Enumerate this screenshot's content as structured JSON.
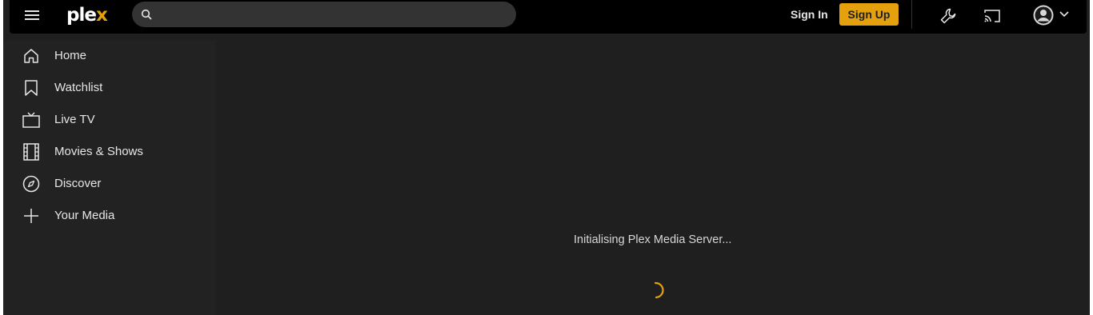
{
  "topbar": {
    "logo_main": "ple",
    "logo_accent": "x",
    "search_placeholder": "",
    "signin_label": "Sign In",
    "signup_label": "Sign Up",
    "icons": [
      "menu-icon",
      "search-icon",
      "wrench-icon",
      "cast-icon",
      "avatar-icon",
      "chevron-down-icon"
    ]
  },
  "sidebar": {
    "items": [
      {
        "label": "Home",
        "icon": "home-icon"
      },
      {
        "label": "Watchlist",
        "icon": "bookmark-icon"
      },
      {
        "label": "Live TV",
        "icon": "tv-icon"
      },
      {
        "label": "Movies & Shows",
        "icon": "film-icon"
      },
      {
        "label": "Discover",
        "icon": "compass-icon"
      },
      {
        "label": "Your Media",
        "icon": "plus-icon"
      }
    ]
  },
  "main": {
    "status_text": "Initialising Plex Media Server..."
  },
  "colors": {
    "accent": "#e5a00d",
    "background": "#1f1f1f",
    "topbar": "#000000",
    "sidebar": "#222222"
  }
}
